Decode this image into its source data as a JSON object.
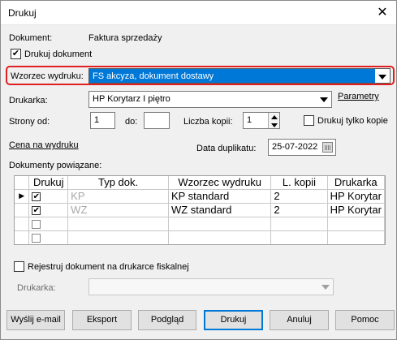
{
  "window": {
    "title": "Drukuj",
    "close_glyph": "✕"
  },
  "document": {
    "label": "Dokument:",
    "value": "Faktura sprzedaży"
  },
  "print_document": {
    "label": "Drukuj dokument",
    "checked": true,
    "mark": "✔"
  },
  "template": {
    "label": "Wzorzec wydruku:",
    "value": "FS akcyza, dokument dostawy"
  },
  "printer": {
    "label": "Drukarka:",
    "value": "HP Korytarz I piętro",
    "link": "Parametry"
  },
  "pages": {
    "from_label": "Strony od:",
    "from_value": "1",
    "to_label": "do:",
    "to_value": ""
  },
  "copies": {
    "label": "Liczba kopii:",
    "value": "1"
  },
  "print_copies_only": {
    "label": "Drukuj tylko kopie",
    "checked": false
  },
  "price_link": "Cena na wydruku",
  "duplicate_date": {
    "label": "Data duplikatu:",
    "value": "25-07-2022"
  },
  "related": {
    "label": "Dokumenty powiązane:",
    "columns": [
      "Drukuj",
      "Typ dok.",
      "Wzorzec wydruku",
      "L. kopii",
      "Drukarka"
    ],
    "rows": [
      {
        "indicator": "▶",
        "print": "✔",
        "type": "KP",
        "template": "KP standard",
        "copies": "2",
        "printer": "HP Korytar"
      },
      {
        "indicator": "",
        "print": "✔",
        "type": "WZ",
        "template": "WZ standard",
        "copies": "2",
        "printer": "HP Korytar"
      },
      {
        "indicator": "",
        "print": "",
        "type": "",
        "template": "",
        "copies": "",
        "printer": ""
      },
      {
        "indicator": "",
        "print": "",
        "type": "",
        "template": "",
        "copies": "",
        "printer": ""
      }
    ]
  },
  "fiscal": {
    "label": "Rejestruj dokument na drukarce fiskalnej",
    "checked": false
  },
  "fiscal_printer": {
    "label": "Drukarka:",
    "value": ""
  },
  "buttons": {
    "email": "Wyślij e-mail",
    "export": "Eksport",
    "preview": "Podgląd",
    "print": "Drukuj",
    "cancel": "Anuluj",
    "help": "Pomoc"
  },
  "colors": {
    "highlight": "#e02020",
    "selection": "#0078d7"
  }
}
